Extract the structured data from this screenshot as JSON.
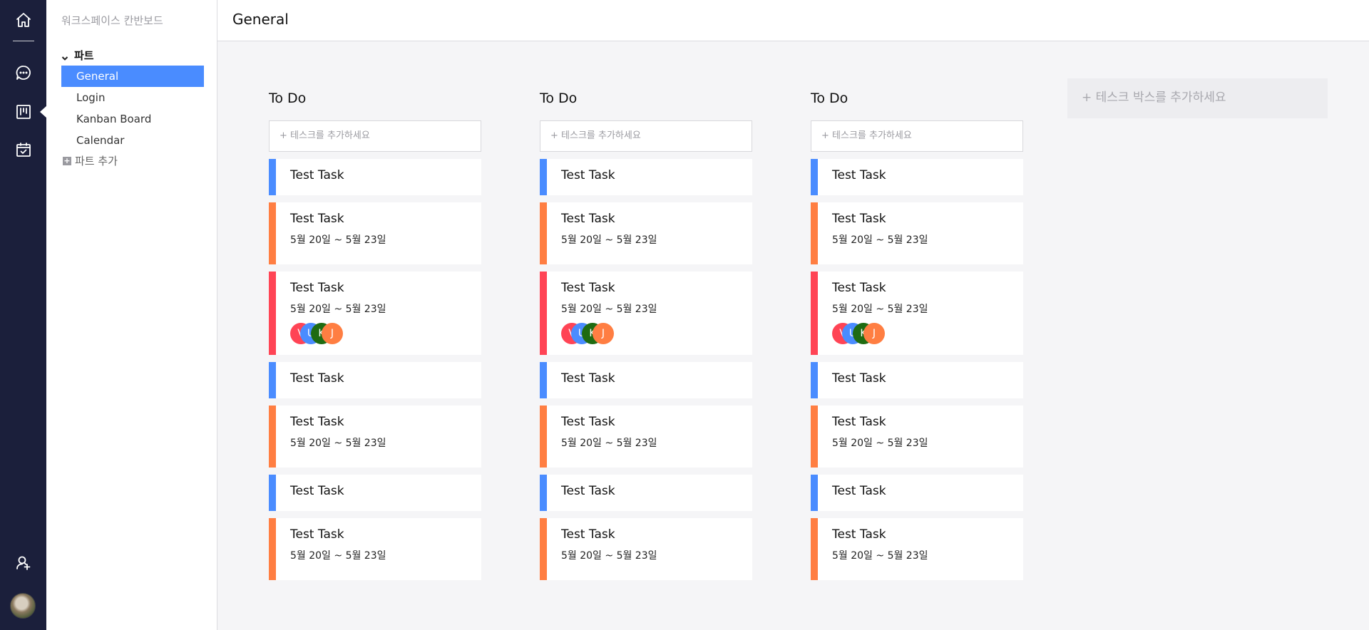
{
  "app": {
    "page_title": "General"
  },
  "rail": {
    "icons": [
      "home-icon",
      "chat-icon",
      "kanban-icon",
      "calendar-check-icon",
      "invite-user-icon"
    ],
    "colors": {
      "background": "#1b1f3b",
      "icon": "#ffffff"
    }
  },
  "sidebar": {
    "workspace_title": "워크스페이스 칸반보드",
    "part_label": "파트",
    "items": [
      {
        "label": "General",
        "active": true
      },
      {
        "label": "Login",
        "active": false
      },
      {
        "label": "Kanban Board",
        "active": false
      },
      {
        "label": "Calendar",
        "active": false
      }
    ],
    "add_part_label": "파트 추가",
    "colors": {
      "active": "#4a8cff"
    }
  },
  "board": {
    "columns": [
      {
        "title": "To Do",
        "add_task_placeholder": "+ 테스크를 추가하세요",
        "cards": [
          {
            "title": "Test Task",
            "color": "#4a8cff",
            "kind": "simple"
          },
          {
            "title": "Test Task",
            "date": "5월 20일 ~ 5월 23일",
            "color": "#ff7e42",
            "kind": "dated"
          },
          {
            "title": "Test Task",
            "date": "5월 20일 ~ 5월 23일",
            "color": "#ff4455",
            "kind": "full",
            "assignees": [
              {
                "initial": "V",
                "color": "#ff4455"
              },
              {
                "initial": "U",
                "color": "#4a8cff"
              },
              {
                "initial": "K",
                "color": "#1f6b12"
              },
              {
                "initial": "J",
                "color": "#ff7e42"
              }
            ]
          },
          {
            "title": "Test Task",
            "color": "#4a8cff",
            "kind": "simple"
          },
          {
            "title": "Test Task",
            "date": "5월 20일 ~ 5월 23일",
            "color": "#ff7e42",
            "kind": "dated"
          },
          {
            "title": "Test Task",
            "color": "#4a8cff",
            "kind": "simple"
          },
          {
            "title": "Test Task",
            "date": "5월 20일 ~ 5월 23일",
            "color": "#ff7e42",
            "kind": "dated"
          }
        ]
      },
      {
        "title": "To Do",
        "add_task_placeholder": "+ 테스크를 추가하세요",
        "cards": [
          {
            "title": "Test Task",
            "color": "#4a8cff",
            "kind": "simple"
          },
          {
            "title": "Test Task",
            "date": "5월 20일 ~ 5월 23일",
            "color": "#ff7e42",
            "kind": "dated"
          },
          {
            "title": "Test Task",
            "date": "5월 20일 ~ 5월 23일",
            "color": "#ff4455",
            "kind": "full",
            "assignees": [
              {
                "initial": "V",
                "color": "#ff4455"
              },
              {
                "initial": "U",
                "color": "#4a8cff"
              },
              {
                "initial": "K",
                "color": "#1f6b12"
              },
              {
                "initial": "J",
                "color": "#ff7e42"
              }
            ]
          },
          {
            "title": "Test Task",
            "color": "#4a8cff",
            "kind": "simple"
          },
          {
            "title": "Test Task",
            "date": "5월 20일 ~ 5월 23일",
            "color": "#ff7e42",
            "kind": "dated"
          },
          {
            "title": "Test Task",
            "color": "#4a8cff",
            "kind": "simple"
          },
          {
            "title": "Test Task",
            "date": "5월 20일 ~ 5월 23일",
            "color": "#ff7e42",
            "kind": "dated"
          }
        ]
      },
      {
        "title": "To Do",
        "add_task_placeholder": "+ 테스크를 추가하세요",
        "cards": [
          {
            "title": "Test Task",
            "color": "#4a8cff",
            "kind": "simple"
          },
          {
            "title": "Test Task",
            "date": "5월 20일 ~ 5월 23일",
            "color": "#ff7e42",
            "kind": "dated"
          },
          {
            "title": "Test Task",
            "date": "5월 20일 ~ 5월 23일",
            "color": "#ff4455",
            "kind": "full",
            "assignees": [
              {
                "initial": "V",
                "color": "#ff4455"
              },
              {
                "initial": "U",
                "color": "#4a8cff"
              },
              {
                "initial": "K",
                "color": "#1f6b12"
              },
              {
                "initial": "J",
                "color": "#ff7e42"
              }
            ]
          },
          {
            "title": "Test Task",
            "color": "#4a8cff",
            "kind": "simple"
          },
          {
            "title": "Test Task",
            "date": "5월 20일 ~ 5월 23일",
            "color": "#ff7e42",
            "kind": "dated"
          },
          {
            "title": "Test Task",
            "color": "#4a8cff",
            "kind": "simple"
          },
          {
            "title": "Test Task",
            "date": "5월 20일 ~ 5월 23일",
            "color": "#ff7e42",
            "kind": "dated"
          }
        ]
      }
    ],
    "add_box_label": "+ 테스크 박스를 추가하세요"
  }
}
